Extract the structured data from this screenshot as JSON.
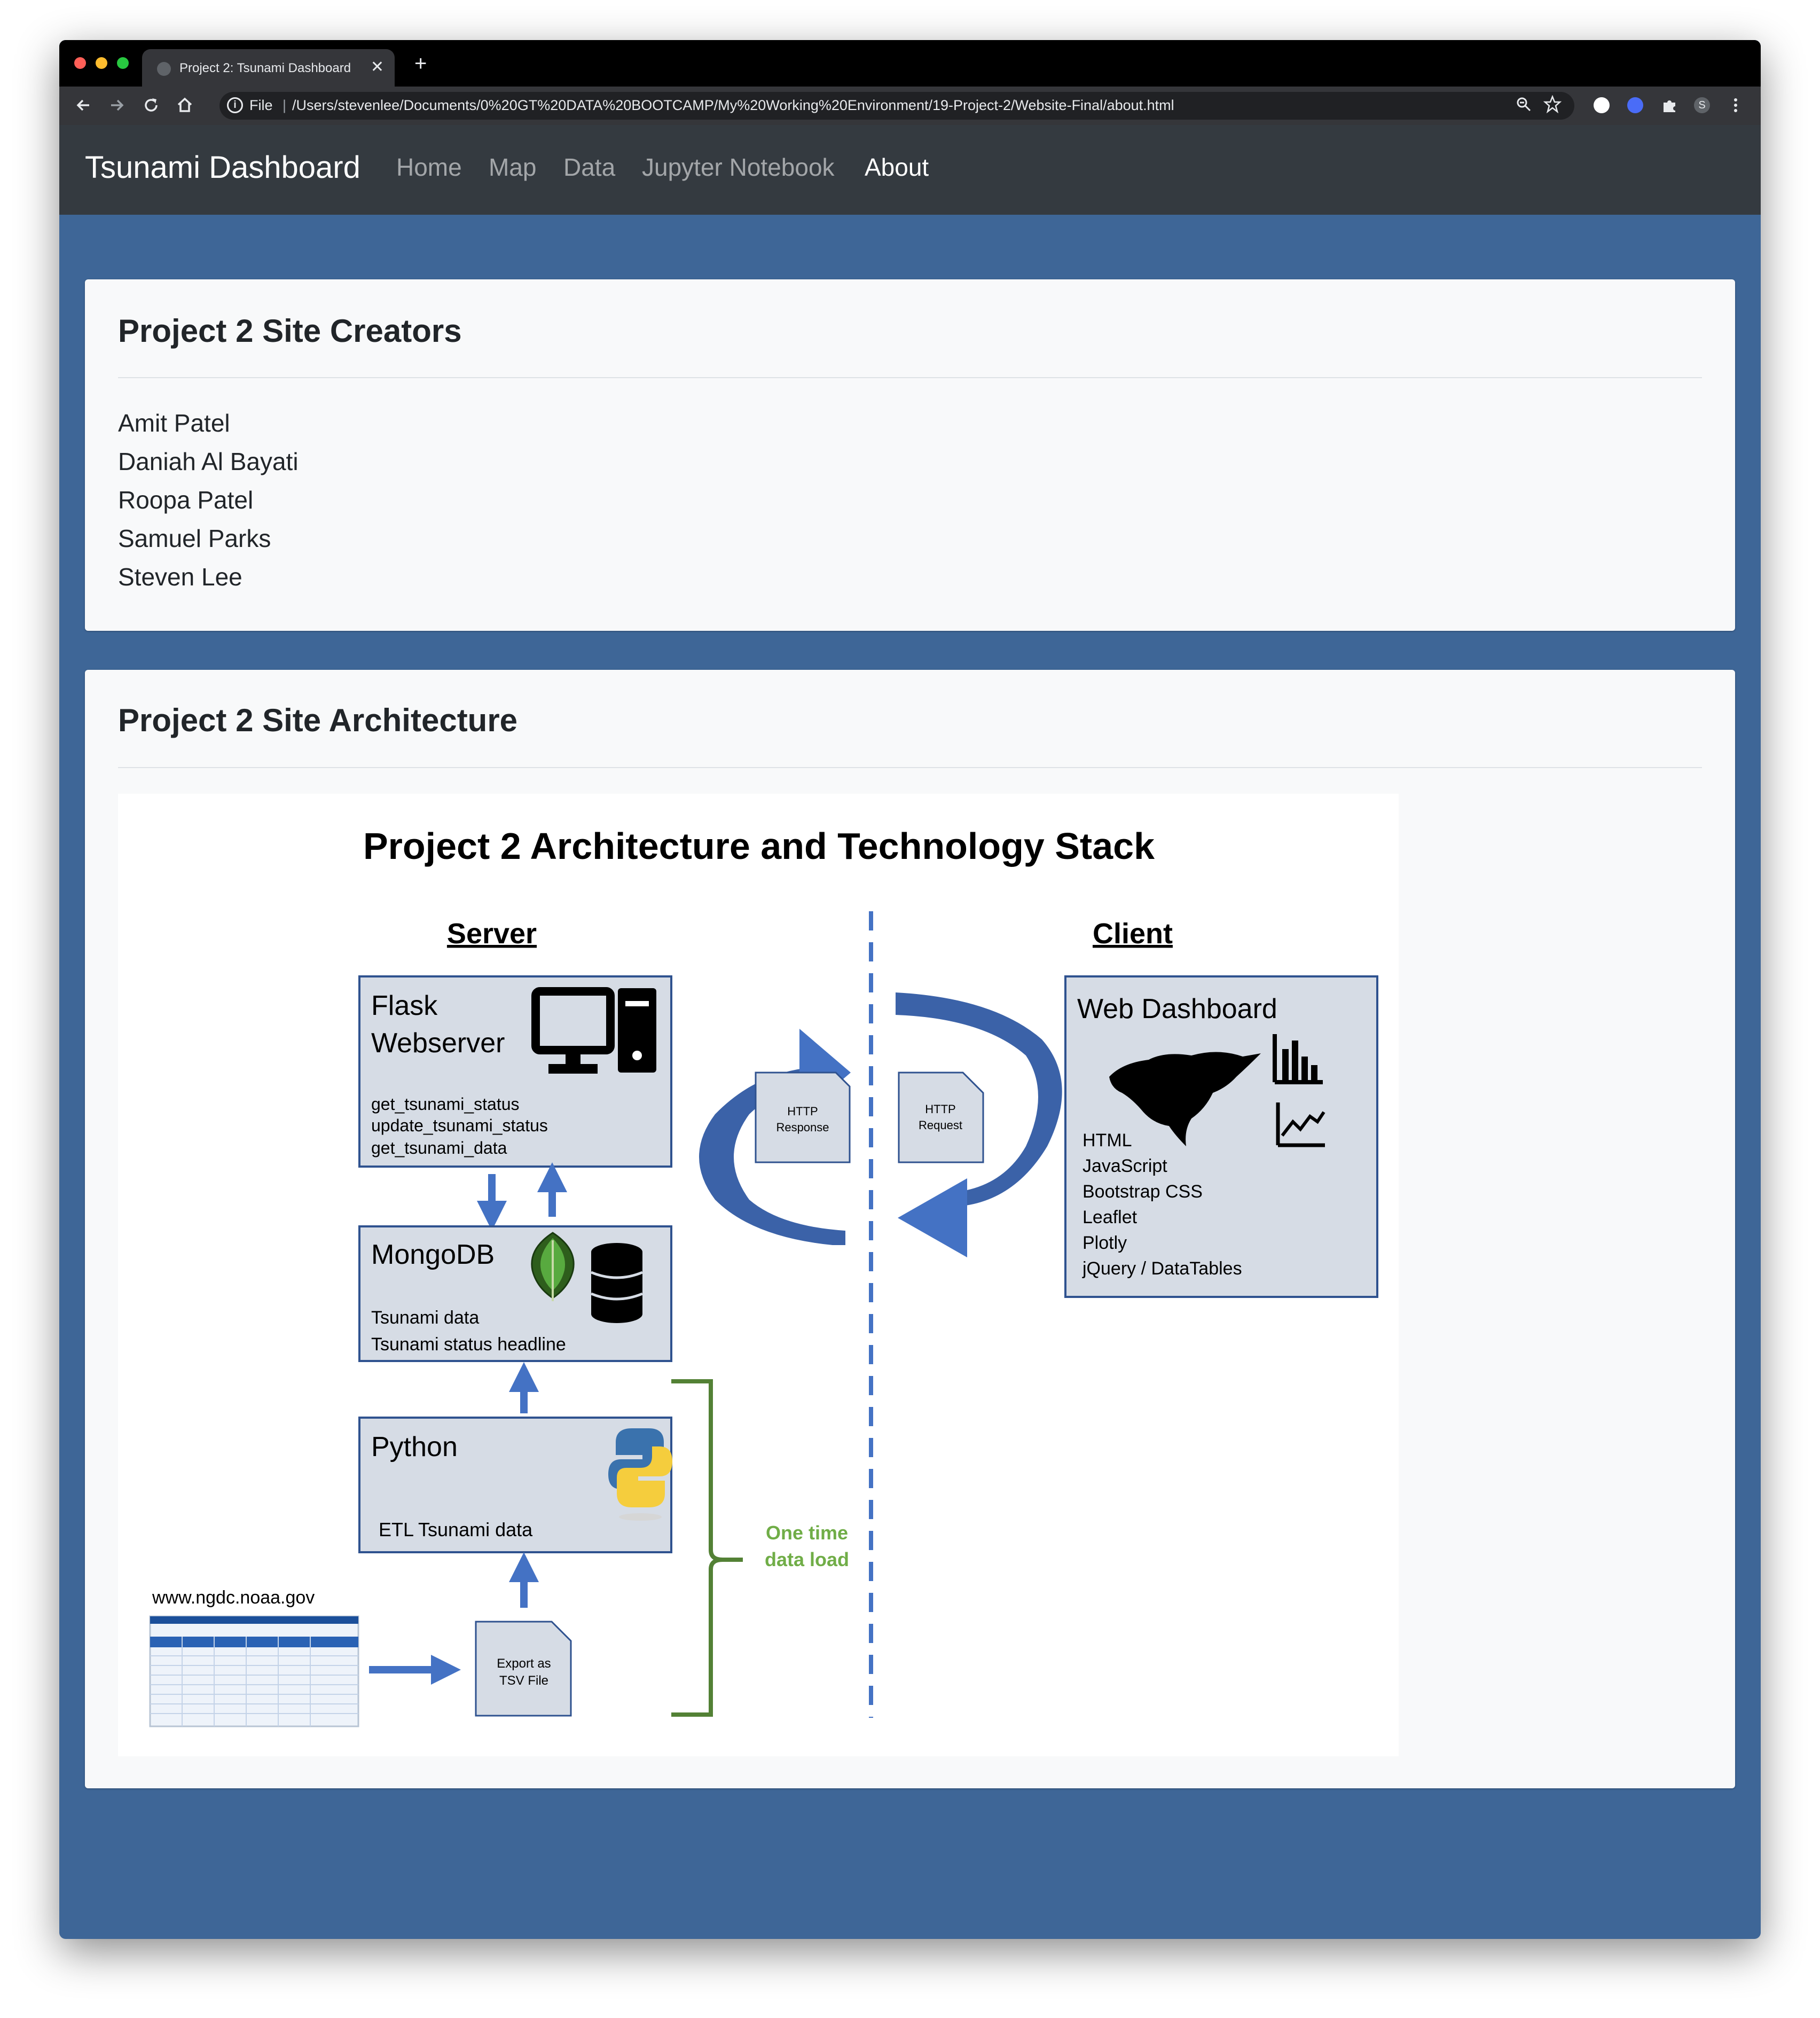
{
  "browser": {
    "tab_title": "Project 2: Tsunami Dashboard",
    "tab_close": "✕",
    "new_tab": "+",
    "address_prefix": "File",
    "url": "/Users/stevenlee/Documents/0%20GT%20DATA%20BOOTCAMP/My%20Working%20Environment/19-Project-2/Website-Final/about.html",
    "profile_initial": "S",
    "icons": [
      "back-icon",
      "forward-icon",
      "reload-icon",
      "home-icon",
      "info-icon",
      "zoom-icon",
      "bookmark-star-icon",
      "extension-icon",
      "puzzle-icon",
      "menu-icon"
    ]
  },
  "navbar": {
    "brand": "Tsunami Dashboard",
    "links": [
      "Home",
      "Map",
      "Data",
      "Jupyter Notebook",
      "About"
    ],
    "active": "About"
  },
  "creators_card": {
    "title": "Project 2 Site Creators",
    "names": [
      "Amit Patel",
      "Daniah Al Bayati",
      "Roopa Patel",
      "Samuel Parks",
      "Steven Lee"
    ]
  },
  "architecture_card": {
    "title": "Project 2 Site Architecture",
    "diagram": {
      "title": "Project 2 Architecture and Technology Stack",
      "server_label": "Server",
      "client_label": "Client",
      "flask": {
        "title_line1": "Flask",
        "title_line2": "Webserver",
        "routes": [
          "get_tsunami_status",
          "update_tsunami_status",
          "get_tsunami_data"
        ]
      },
      "mongodb": {
        "title": "MongoDB",
        "lines": [
          "Tsunami data",
          "Tsunami status headline"
        ]
      },
      "python": {
        "title": "Python",
        "line": "ETL Tsunami data"
      },
      "web_dashboard": {
        "title": "Web Dashboard",
        "tech": [
          "HTML",
          "JavaScript",
          "Bootstrap CSS",
          "Leaflet",
          "Plotly",
          "jQuery / DataTables"
        ]
      },
      "http_response": [
        "HTTP",
        "Response"
      ],
      "http_request": [
        "HTTP",
        "Request"
      ],
      "one_time": [
        "One time",
        "data load"
      ],
      "source_site": "www.ngdc.noaa.gov",
      "export": [
        "Export as",
        "TSV File"
      ],
      "colors": {
        "box_fill": "#d6dce5",
        "box_stroke": "#2f528f",
        "arrow": "#4472c4",
        "bracket": "#538135",
        "green_text": "#70ad47"
      }
    }
  }
}
